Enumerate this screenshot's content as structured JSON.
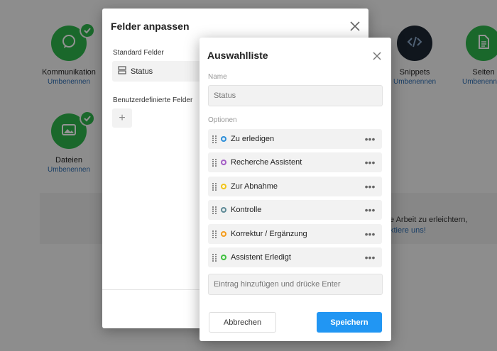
{
  "background": {
    "apps": [
      {
        "name": "Kommunikation",
        "rename": "Umbenennen",
        "icon": "chat-icon"
      },
      {
        "name": "Dateien",
        "rename": "Umbenennen",
        "icon": "image-icon"
      },
      {
        "name": "Snippets",
        "rename": "Umbenennen",
        "icon": "code-icon"
      },
      {
        "name": "Seiten",
        "rename": "Umbenennen",
        "icon": "page-icon"
      }
    ],
    "banner_text": "e Arbeit zu erleichtern,",
    "banner_link": "ktiere uns!"
  },
  "fields_modal": {
    "title": "Felder anpassen",
    "standard_label": "Standard Felder",
    "standard_field": "Status",
    "custom_label": "Benutzerdefinierte Felder",
    "add_symbol": "+"
  },
  "choice_modal": {
    "title": "Auswahlliste",
    "name_label": "Name",
    "name_placeholder": "Status",
    "options_label": "Optionen",
    "options": [
      {
        "label": "Zu erledigen",
        "color": "#2f8fd8"
      },
      {
        "label": "Recherche Assistent",
        "color": "#a35ec4"
      },
      {
        "label": "Zur Abnahme",
        "color": "#f0c419"
      },
      {
        "label": "Kontrolle",
        "color": "#5f8a96"
      },
      {
        "label": "Korrektur / Ergänzung",
        "color": "#f29c1f"
      },
      {
        "label": "Assistent Erledigt",
        "color": "#3fbf3f"
      }
    ],
    "more_symbol": "•••",
    "add_placeholder": "Eintrag hinzufügen und drücke Enter",
    "cancel_label": "Abbrechen",
    "save_label": "Speichern"
  }
}
